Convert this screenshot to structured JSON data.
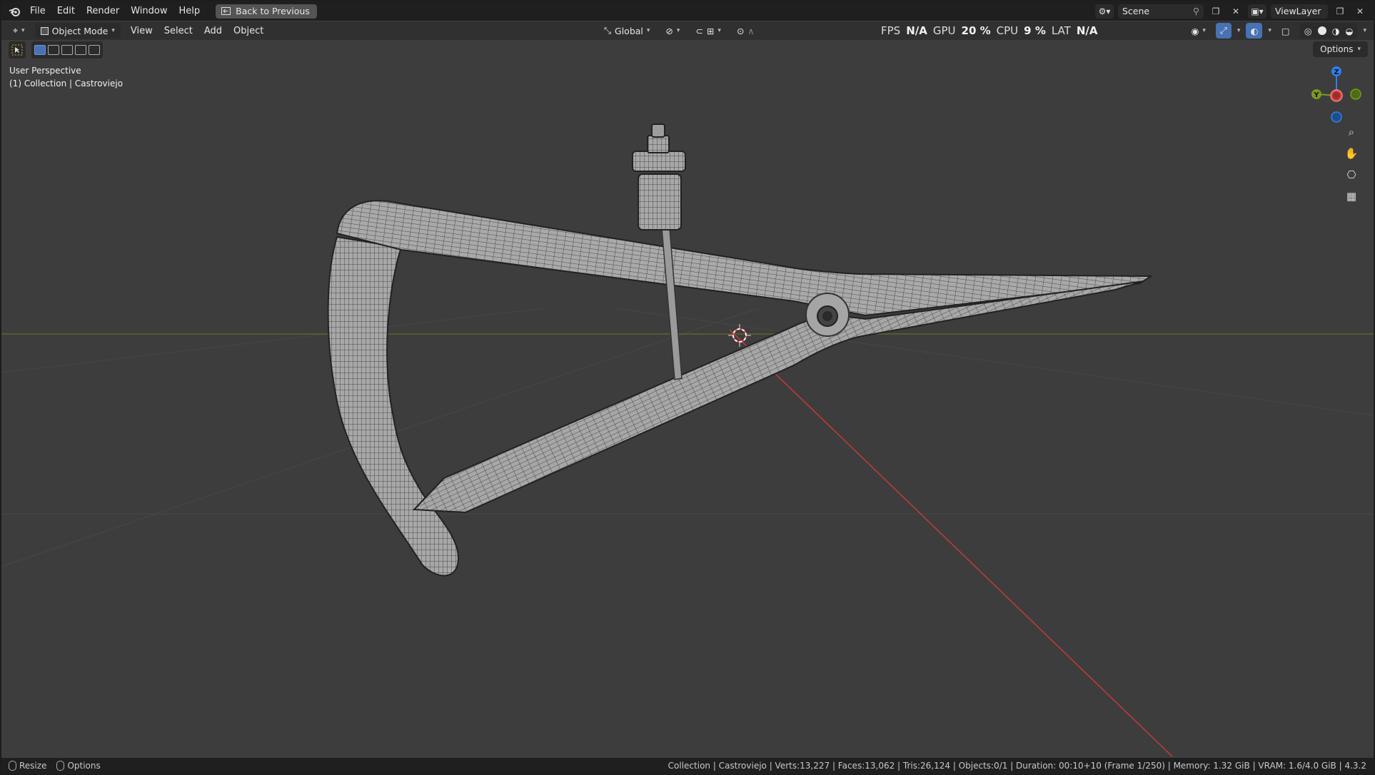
{
  "menu": {
    "items": [
      "File",
      "Edit",
      "Render",
      "Window",
      "Help"
    ],
    "back_button": "Back to Previous"
  },
  "topbar_right": {
    "scene": "Scene",
    "view_layer": "ViewLayer"
  },
  "header": {
    "mode": "Object Mode",
    "menus": [
      "View",
      "Select",
      "Add",
      "Object"
    ],
    "orientation": "Global",
    "options": "Options"
  },
  "stats": {
    "fps_label": "FPS",
    "fps_value": "N/A",
    "gpu_label": "GPU",
    "gpu_value": "20 %",
    "cpu_label": "CPU",
    "cpu_value": "9 %",
    "lat_label": "LAT",
    "lat_value": "N/A"
  },
  "viewport": {
    "view_name": "User Perspective",
    "collection_line": "(1) Collection | Castroviejo"
  },
  "gizmo": {
    "z": "Z",
    "y": "Y"
  },
  "statusbar": {
    "left_items": [
      "Resize",
      "Options"
    ],
    "info": "Collection | Castroviejo | Verts:13,227 | Faces:13,062 | Tris:26,124 | Objects:0/1 | Duration: 00:10+10 (Frame 1/250) | Memory: 1.32 GiB | VRAM: 1.6/4.0 GiB | 4.3.2"
  },
  "colors": {
    "x_axis": "#d04040",
    "y_axis": "#7a9a1a",
    "z_axis": "#2f80ed",
    "accent": "#4772b3"
  }
}
